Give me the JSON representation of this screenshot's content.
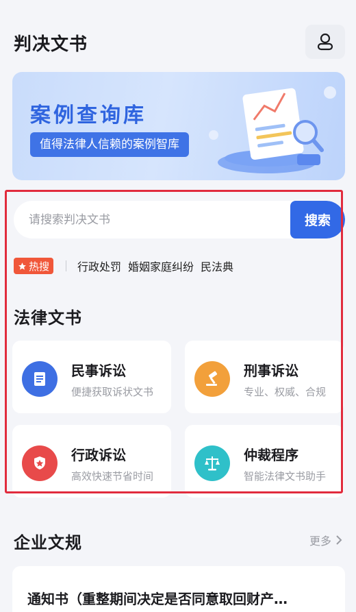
{
  "header": {
    "title": "判决文书",
    "user_icon": "user-icon"
  },
  "banner": {
    "title": "案例查询库",
    "subtitle": "值得法律人信赖的案例智库"
  },
  "search": {
    "placeholder": "请搜索判决文书",
    "button_label": "搜索"
  },
  "hot": {
    "badge_label": "热搜",
    "terms": [
      "行政处罚",
      "婚姻家庭纠纷",
      "民法典"
    ]
  },
  "legal_docs": {
    "title": "法律文书",
    "cards": [
      {
        "title": "民事诉讼",
        "desc": "便捷获取诉状文书",
        "icon": "document-icon",
        "color": "#3e6fe3"
      },
      {
        "title": "刑事诉讼",
        "desc": "专业、权威、合规",
        "icon": "gavel-icon",
        "color": "#f2a03b"
      },
      {
        "title": "行政诉讼",
        "desc": "高效快速节省时间",
        "icon": "shield-star-icon",
        "color": "#e84a4a"
      },
      {
        "title": "仲裁程序",
        "desc": "智能法律文书助手",
        "icon": "scales-icon",
        "color": "#2fc0c9"
      }
    ]
  },
  "enterprise": {
    "title": "企业文规",
    "more_label": "更多",
    "items": [
      {
        "title": "通知书（重整期间决定是否同意取回财产…"
      }
    ]
  },
  "colors": {
    "accent": "#3269e6",
    "hot_badge": "#f0573a",
    "highlight": "#e12b3d"
  }
}
